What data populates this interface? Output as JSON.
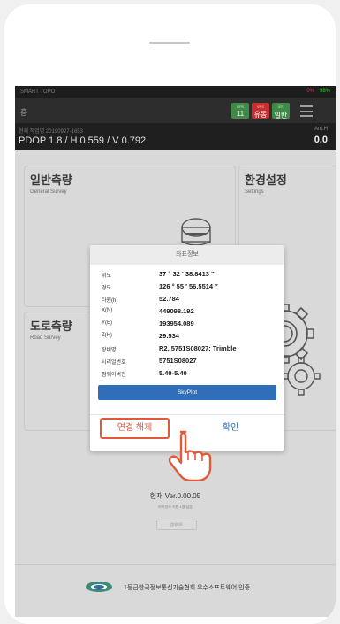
{
  "status": {
    "app": "SMART TOPO",
    "error_pct": "0%",
    "battery": "98%"
  },
  "topbar": {
    "home_label": "홈",
    "gps": {
      "label": "GPS",
      "value": "11"
    },
    "vrs": {
      "label": "VRS",
      "value": "유동"
    },
    "mode": {
      "label": "모드",
      "value": "일반"
    }
  },
  "info": {
    "job": "현재 작업명 20190927-1653",
    "pdop": "PDOP 1.8 / H 0.559 / V 0.792",
    "ant_label": "Ant.H",
    "ant_value": "0.0"
  },
  "cards": {
    "general": {
      "title": "일반측량",
      "subtitle": "General Survey"
    },
    "settings": {
      "title": "환경설정",
      "subtitle": "Settings"
    },
    "road": {
      "title": "도로측량",
      "subtitle": "Road Survey"
    }
  },
  "dialog": {
    "title": "좌표정보",
    "rows": [
      {
        "label": "위도",
        "value": "37 ° 32 ′ 38.8413 ″"
      },
      {
        "label": "경도",
        "value": "126 ° 55 ′ 56.5514 ″"
      },
      {
        "label": "타원(h)",
        "value": "52.784"
      },
      {
        "label": "X(N)",
        "value": "449098.192"
      },
      {
        "label": "Y(E)",
        "value": "193954.089"
      },
      {
        "label": "Z(H)",
        "value": "29.534"
      },
      {
        "label": "장비명",
        "value": "R2, 5751S08027: Trimble"
      },
      {
        "label": "시리얼번호",
        "value": "5751S08027"
      },
      {
        "label": "펌웨어버전",
        "value": "5.40-5.40"
      }
    ],
    "skyplot_label": "SkyPlot",
    "disconnect_label": "연결 해제",
    "confirm_label": "확인"
  },
  "version": {
    "text": "현재 Ver.0.00.05",
    "date": "라이선스 기한 1일 남음",
    "update_label": "업데이트"
  },
  "footer": {
    "text": "1등급한국정보통신기술협회 우수소프트웨어 인증"
  },
  "colors": {
    "accent_blue": "#2f6fb9",
    "highlight_orange": "#e05a3a",
    "gps_green": "#3f8a46",
    "vrs_red": "#c62f2f"
  }
}
